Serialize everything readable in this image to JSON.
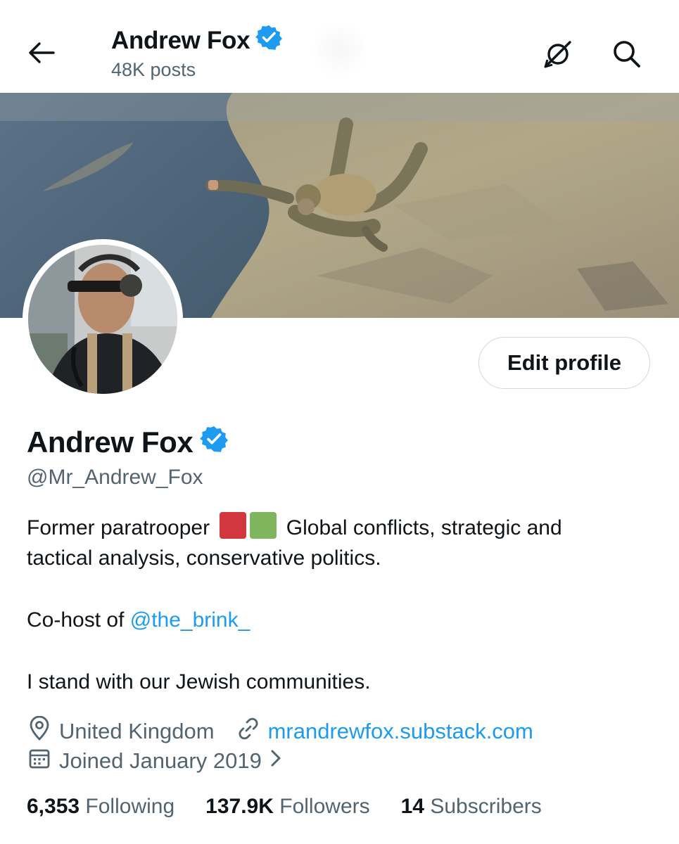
{
  "header": {
    "name": "Andrew Fox",
    "posts": "48K posts"
  },
  "profile": {
    "name": "Andrew Fox",
    "handle": "@Mr_Andrew_Fox",
    "edit_label": "Edit profile",
    "bio": {
      "line1_a": "Former paratrooper",
      "line1_b": "Global conflicts, strategic and",
      "line2": "tactical analysis, conservative politics.",
      "cohost_prefix": "Co-host of",
      "cohost_link": "@the_brink_",
      "line4": "I stand with our Jewish communities."
    },
    "flag_colors": [
      "#d2373e",
      "#7fb55c"
    ],
    "location": "United Kingdom",
    "website": "mrandrewfox.substack.com",
    "joined": "Joined January 2019",
    "stats": [
      {
        "value": "6,353",
        "label": "Following"
      },
      {
        "value": "137.9K",
        "label": "Followers"
      },
      {
        "value": "14",
        "label": "Subscribers"
      }
    ]
  },
  "colors": {
    "accent": "#1d9bf0",
    "verified": "#1d9bf0",
    "muted": "#536471"
  },
  "icons": [
    "back-arrow-icon",
    "verified-badge-icon",
    "satellite-off-icon",
    "search-icon",
    "location-pin-icon",
    "link-icon",
    "calendar-icon",
    "chevron-right-icon"
  ]
}
